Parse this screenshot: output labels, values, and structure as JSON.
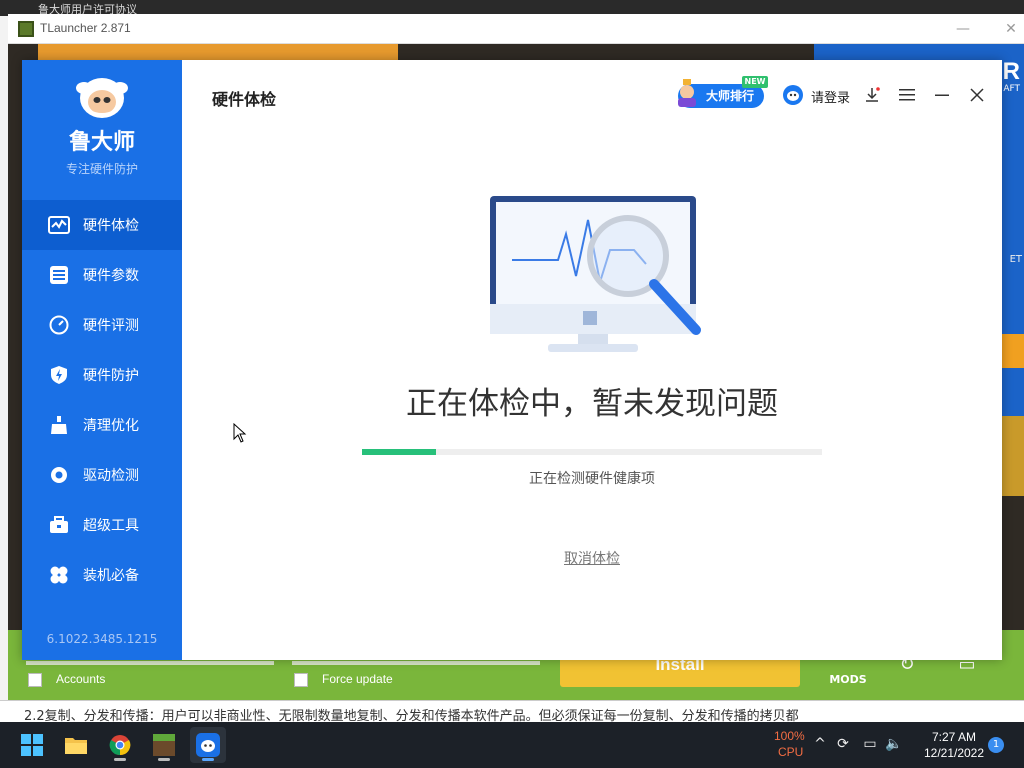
{
  "behind_app": {
    "title": "鲁大师用户许可协议"
  },
  "tlauncher": {
    "title": "TLauncher 2.871",
    "brand_letter": "R",
    "brand_sub": "AFT",
    "side_text": "ET",
    "accounts_label": "Accounts",
    "force_update_label": "Force update",
    "install_label": "Install",
    "mods_label": "MODS",
    "minimize_glyph": "—",
    "maximize_glyph": "☐",
    "close_glyph": "✕"
  },
  "document_text": "2.2复制、分发和传播：用户可以非商业性、无限制数量地复制、分发和传播本软件产品。但必须保证每一份复制、分发和传播的拷贝都",
  "ludashi": {
    "logo_name": "鲁大师",
    "logo_sub": "专注硬件防护",
    "version": "6.1022.3485.1215",
    "nav": [
      {
        "label": "硬件体检",
        "icon": "pulse-icon"
      },
      {
        "label": "硬件参数",
        "icon": "sliders-icon"
      },
      {
        "label": "硬件评测",
        "icon": "gauge-icon"
      },
      {
        "label": "硬件防护",
        "icon": "shield-bolt-icon"
      },
      {
        "label": "清理优化",
        "icon": "broom-icon"
      },
      {
        "label": "驱动检测",
        "icon": "gear-icon"
      },
      {
        "label": "超级工具",
        "icon": "toolbox-icon"
      },
      {
        "label": "装机必备",
        "icon": "clover-icon"
      }
    ],
    "active_nav": 0,
    "page_title": "硬件体检",
    "rank_label": "大师排行",
    "new_badge": "NEW",
    "login_label": "请登录",
    "status_title": "正在体检中，暂未发现问题",
    "progress": 0.16,
    "sub_status": "正在检测硬件健康项",
    "cancel_label": "取消体检",
    "colors": {
      "sidebar": "#1a70e6",
      "accent": "#1a78f0",
      "progress": "#27c07a"
    }
  },
  "taskbar": {
    "apps": [
      "windows-start-icon",
      "file-explorer-icon",
      "chrome-icon",
      "minecraft-icon",
      "ludashi-icon"
    ],
    "cpu_percent": "100%",
    "cpu_label": "CPU",
    "time": "7:27 AM",
    "date": "12/21/2022",
    "notifications": "1"
  }
}
